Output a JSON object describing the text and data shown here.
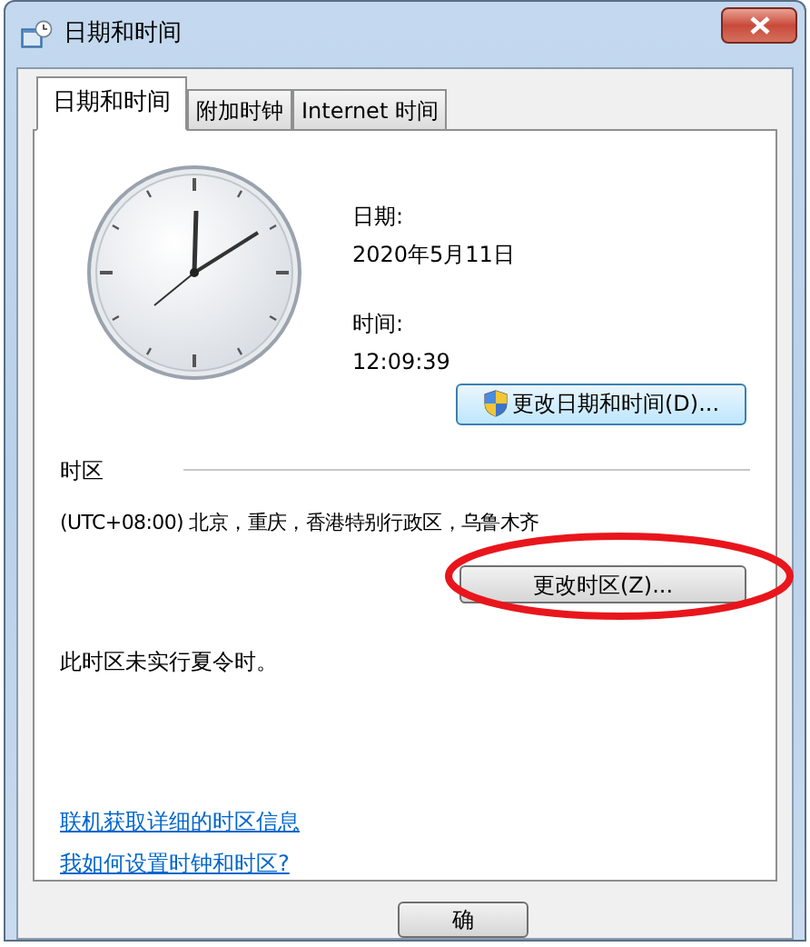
{
  "window": {
    "title": "日期和时间"
  },
  "tabs": [
    {
      "label": "日期和时间",
      "selected": true
    },
    {
      "label": "附加时钟",
      "selected": false
    },
    {
      "label": "Internet 时间",
      "selected": false
    }
  ],
  "date": {
    "label": "日期:",
    "value": "2020年5月11日"
  },
  "time": {
    "label": "时间:",
    "value": "12:09:39"
  },
  "change_datetime_button": "更改日期和时间(D)...",
  "time_zone": {
    "heading": "时区",
    "value": "(UTC+08:00) 北京，重庆，香港特别行政区，乌鲁木齐",
    "button": "更改时区(Z)...",
    "dst_note": "此时区未实行夏令时。"
  },
  "links": [
    "联机获取详细的时区信息",
    "我如何设置时钟和时区?"
  ],
  "buttons": [
    "确"
  ]
}
